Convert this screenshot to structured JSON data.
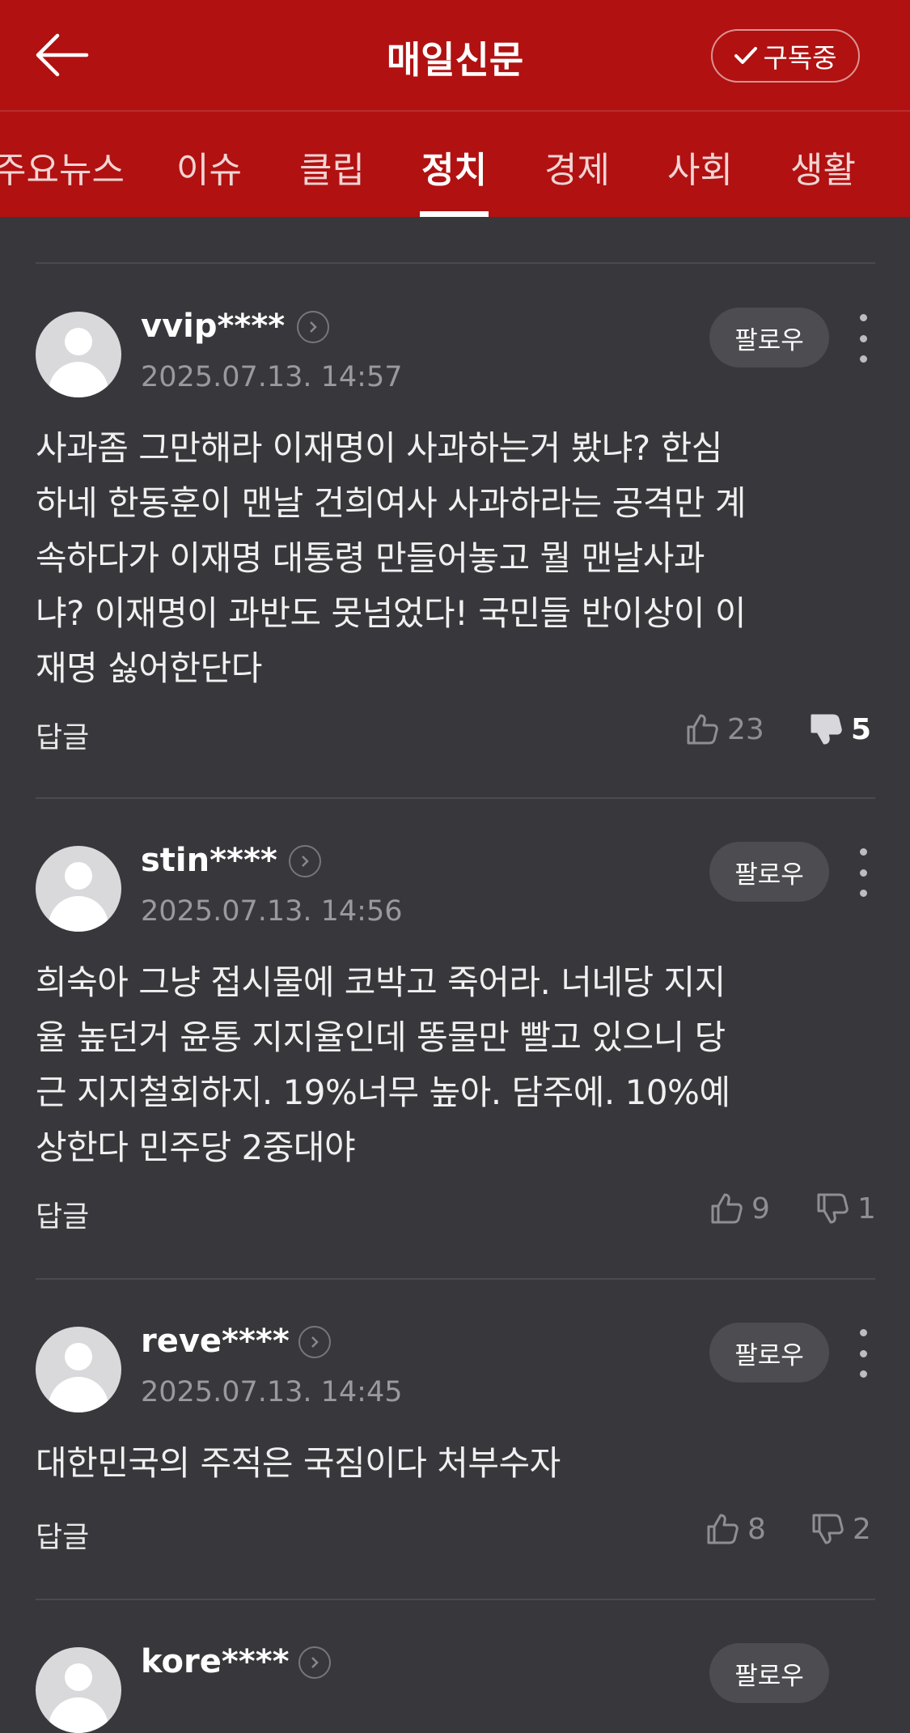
{
  "header": {
    "back_label": "",
    "title": "매일신문",
    "subscribe_label": "구독중"
  },
  "tabs": [
    {
      "label": "주요뉴스",
      "active": false
    },
    {
      "label": "이슈",
      "active": false
    },
    {
      "label": "클립",
      "active": false
    },
    {
      "label": "정치",
      "active": true
    },
    {
      "label": "경제",
      "active": false
    },
    {
      "label": "사회",
      "active": false
    },
    {
      "label": "생활",
      "active": false
    }
  ],
  "comments": [
    {
      "username": "vvip****",
      "timestamp": "2025.07.13. 14:57",
      "follow_label": "팔로우",
      "lines": [
        "사과좀 그만해라 이재명이 사과하는거 봤냐? 한심",
        "하네 한동훈이 맨날 건희여사 사과하라는 공격만 계",
        "속하다가 이재명 대통령 만들어놓고 뭘 맨날사과",
        "냐? 이재명이 과반도 못넘었다! 국민들 반이상이 이",
        "재명 싫어한단다"
      ],
      "reply_label": "답글",
      "likes": "23",
      "dislikes": "5"
    },
    {
      "username": "stin****",
      "timestamp": "2025.07.13. 14:56",
      "follow_label": "팔로우",
      "lines": [
        "희숙아 그냥 접시물에 코박고 죽어라. 너네당 지지",
        "율 높던거 윤통 지지율인데 똥물만 빨고 있으니 당",
        "근 지지철회하지. 19%너무 높아. 담주에. 10%예",
        "상한다 민주당 2중대야"
      ],
      "reply_label": "답글",
      "likes": "9",
      "dislikes": "1"
    },
    {
      "username": "reve****",
      "timestamp": "2025.07.13. 14:45",
      "follow_label": "팔로우",
      "lines": [
        "대한민국의 주적은 국짐이다 처부수자"
      ],
      "reply_label": "답글",
      "likes": "8",
      "dislikes": "2"
    },
    {
      "username": "kore****",
      "timestamp": "",
      "follow_label": "팔로우",
      "lines": [],
      "reply_label": "",
      "likes": "",
      "dislikes": ""
    }
  ],
  "colors": {
    "brand_red": "#b11111",
    "background": "#38383c",
    "divider": "#4a4a4f",
    "muted_text": "#9a9a9e"
  }
}
